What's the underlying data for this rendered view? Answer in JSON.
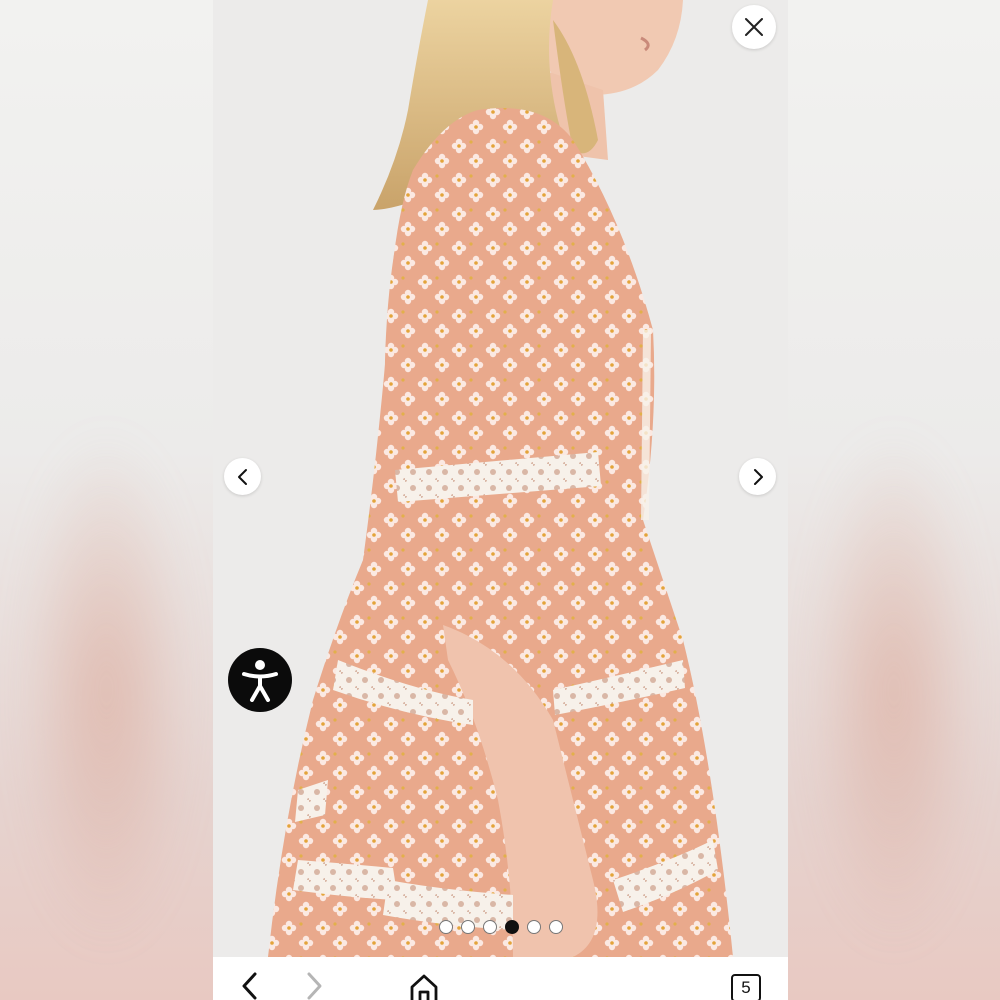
{
  "viewer": {
    "gallery": {
      "slide_count": 6,
      "active_index": 3
    },
    "buttons": {
      "close_icon": "close-icon",
      "prev_icon": "chevron-left-icon",
      "next_icon": "chevron-right-icon",
      "accessibility_icon": "accessibility-icon"
    }
  },
  "toolbar": {
    "back_icon": "chevron-left-icon",
    "forward_icon": "chevron-right-icon",
    "home_icon": "home-icon",
    "tab_count": "5"
  },
  "colors": {
    "dress": "#e9a98c",
    "lace": "#f7f1ea",
    "hair": "#e3c48a",
    "skin": "#f1c9b2",
    "backdrop": "#ecebea",
    "accessibility_button": "#0b0b0b"
  }
}
